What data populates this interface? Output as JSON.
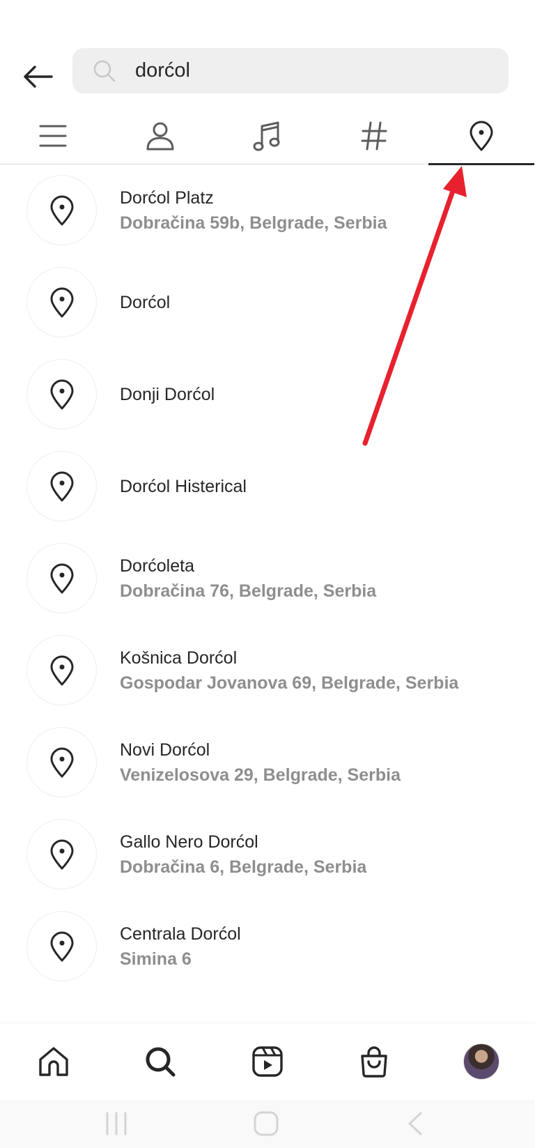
{
  "search": {
    "query": "dorćol",
    "icon": "search-icon"
  },
  "tabs": [
    {
      "name": "tab-top",
      "icon": "menu-lines-icon",
      "active": false
    },
    {
      "name": "tab-accounts",
      "icon": "person-icon",
      "active": false
    },
    {
      "name": "tab-audio",
      "icon": "music-note-icon",
      "active": false
    },
    {
      "name": "tab-tags",
      "icon": "hashtag-icon",
      "active": false
    },
    {
      "name": "tab-places",
      "icon": "location-pin-icon",
      "active": true
    }
  ],
  "results": [
    {
      "title": "Dorćol Platz",
      "subtitle": "Dobračina 59b, Belgrade, Serbia"
    },
    {
      "title": "Dorćol",
      "subtitle": ""
    },
    {
      "title": "Donji Dorćol",
      "subtitle": ""
    },
    {
      "title": "Dorćol Histerical",
      "subtitle": ""
    },
    {
      "title": "Dorćoleta",
      "subtitle": "Dobračina 76, Belgrade, Serbia"
    },
    {
      "title": "Košnica Dorćol",
      "subtitle": "Gospodar Jovanova 69, Belgrade, Serbia"
    },
    {
      "title": "Novi Dorćol",
      "subtitle": "Venizelosova 29, Belgrade, Serbia"
    },
    {
      "title": "Gallo Nero Dorćol",
      "subtitle": "Dobračina 6, Belgrade, Serbia"
    },
    {
      "title": "Centrala Dorćol",
      "subtitle": "Simina 6"
    }
  ],
  "annotation": {
    "color": "#e8212e",
    "icon": "red-arrow-annotation"
  },
  "bottom_nav": [
    "home-icon",
    "search-icon",
    "reels-icon",
    "shop-icon",
    "profile-avatar"
  ],
  "colors": {
    "text": "#262626",
    "secondary": "#8e8e8e",
    "search_bg": "#efefef",
    "divider": "#dbdbdb"
  }
}
